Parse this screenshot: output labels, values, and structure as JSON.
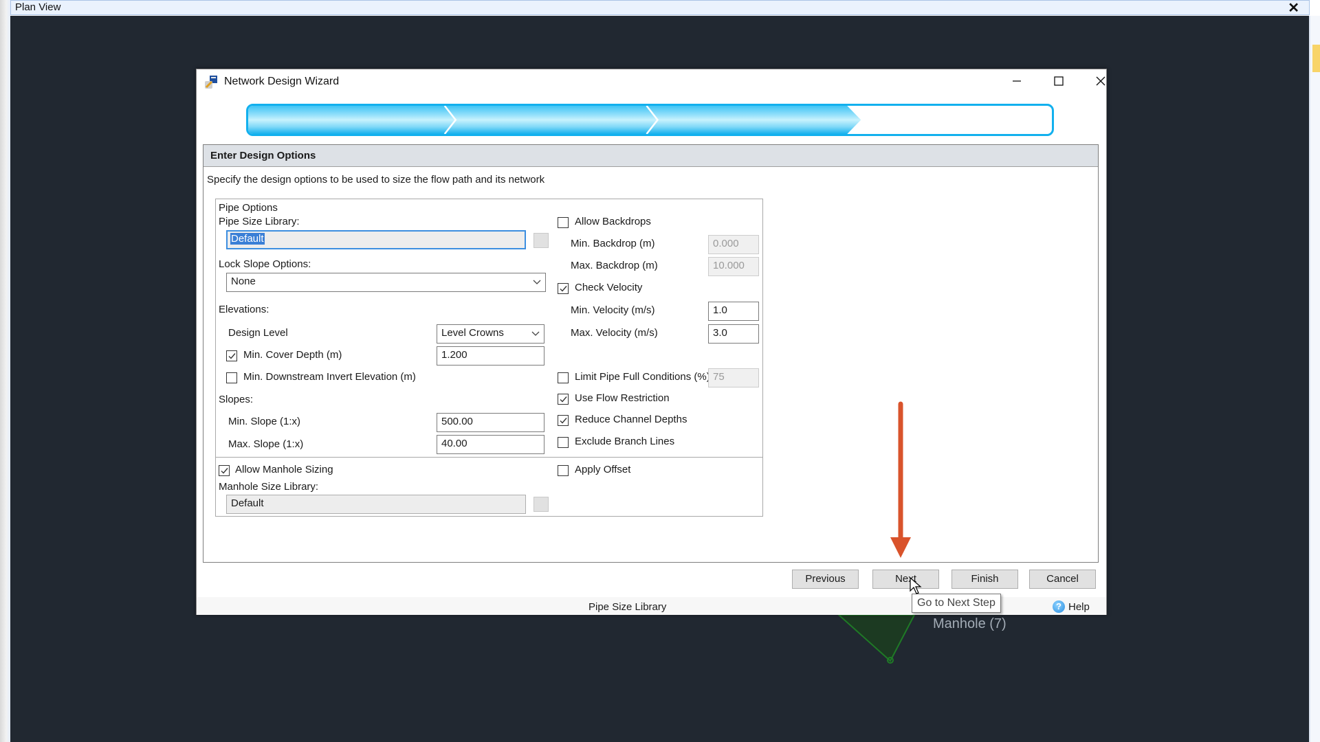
{
  "app": {
    "panel_title": "Plan View",
    "close_glyph": "✕",
    "canvas_label": "Manhole (7)"
  },
  "dialog": {
    "title": "Network Design Wizard",
    "icon": "wizard-app-icon",
    "window_controls": [
      "minimize",
      "maximize",
      "close"
    ],
    "progress": {
      "total_steps": 4,
      "completed_steps": 3,
      "fraction": 0.75
    },
    "step": {
      "title": "Enter Design Options",
      "description": "Specify the design options to be used to size the flow path and its network"
    },
    "pipe_options": {
      "group_label": "Pipe Options",
      "pipe_size_library_label": "Pipe Size Library:",
      "pipe_size_library_value": "Default",
      "lock_slope_label": "Lock Slope Options:",
      "lock_slope_value": "None",
      "elevations_label": "Elevations:",
      "design_level_label": "Design Level",
      "design_level_value": "Level Crowns",
      "min_cover_depth_label": "Min. Cover Depth (m)",
      "min_cover_depth_checked": true,
      "min_cover_depth_value": "1.200",
      "min_downstream_invert_label": "Min. Downstream Invert Elevation (m)",
      "min_downstream_invert_checked": false,
      "slopes_label": "Slopes:",
      "min_slope_label": "Min. Slope (1:x)",
      "min_slope_value": "500.00",
      "max_slope_label": "Max. Slope (1:x)",
      "max_slope_value": "40.00"
    },
    "right_options": {
      "allow_backdrops_label": "Allow Backdrops",
      "allow_backdrops_checked": false,
      "min_backdrop_label": "Min. Backdrop (m)",
      "min_backdrop_value": "0.000",
      "max_backdrop_label": "Max. Backdrop (m)",
      "max_backdrop_value": "10.000",
      "check_velocity_label": "Check Velocity",
      "check_velocity_checked": true,
      "min_velocity_label": "Min. Velocity (m/s)",
      "min_velocity_value": "1.0",
      "max_velocity_label": "Max. Velocity (m/s)",
      "max_velocity_value": "3.0",
      "limit_pipe_full_label": "Limit Pipe Full Conditions (%)",
      "limit_pipe_full_checked": false,
      "limit_pipe_full_value": "75",
      "use_flow_restriction_label": "Use Flow Restriction",
      "use_flow_restriction_checked": true,
      "reduce_channel_depths_label": "Reduce Channel Depths",
      "reduce_channel_depths_checked": true,
      "exclude_branch_lines_label": "Exclude Branch Lines",
      "exclude_branch_lines_checked": false
    },
    "manhole_options": {
      "allow_manhole_sizing_label": "Allow Manhole Sizing",
      "allow_manhole_sizing_checked": true,
      "manhole_size_library_label": "Manhole Size Library:",
      "manhole_size_library_value": "Default",
      "apply_offset_label": "Apply Offset",
      "apply_offset_checked": false
    },
    "buttons": {
      "previous": "Previous",
      "next": "Next",
      "finish": "Finish",
      "cancel": "Cancel"
    },
    "tooltip": "Go to Next Step",
    "status_text": "Pipe Size Library",
    "help_label": "Help",
    "help_icon_glyph": "?"
  },
  "colors": {
    "progress_accent": "#12b0ee",
    "annotation_arrow": "#d9532b",
    "canvas_background": "#212831",
    "manhole_fill": "#1c3a22",
    "manhole_stroke": "#1f7a26"
  }
}
